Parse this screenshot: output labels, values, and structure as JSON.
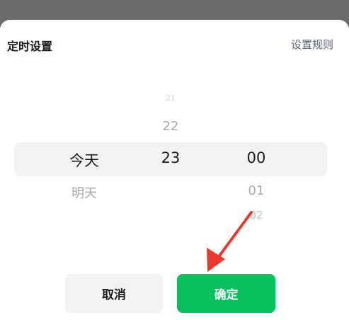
{
  "header": {
    "title": "定时设置",
    "rules_link": "设置规则"
  },
  "picker": {
    "day": {
      "selected": "今天",
      "below": [
        "明天"
      ]
    },
    "hour": {
      "above": [
        "21",
        "22"
      ],
      "selected": "23"
    },
    "minute": {
      "selected": "00",
      "below": [
        "01",
        "02"
      ]
    }
  },
  "buttons": {
    "cancel": "取消",
    "confirm": "确定"
  },
  "colors": {
    "accent": "#07c160",
    "annotation_arrow": "#e8382f"
  }
}
